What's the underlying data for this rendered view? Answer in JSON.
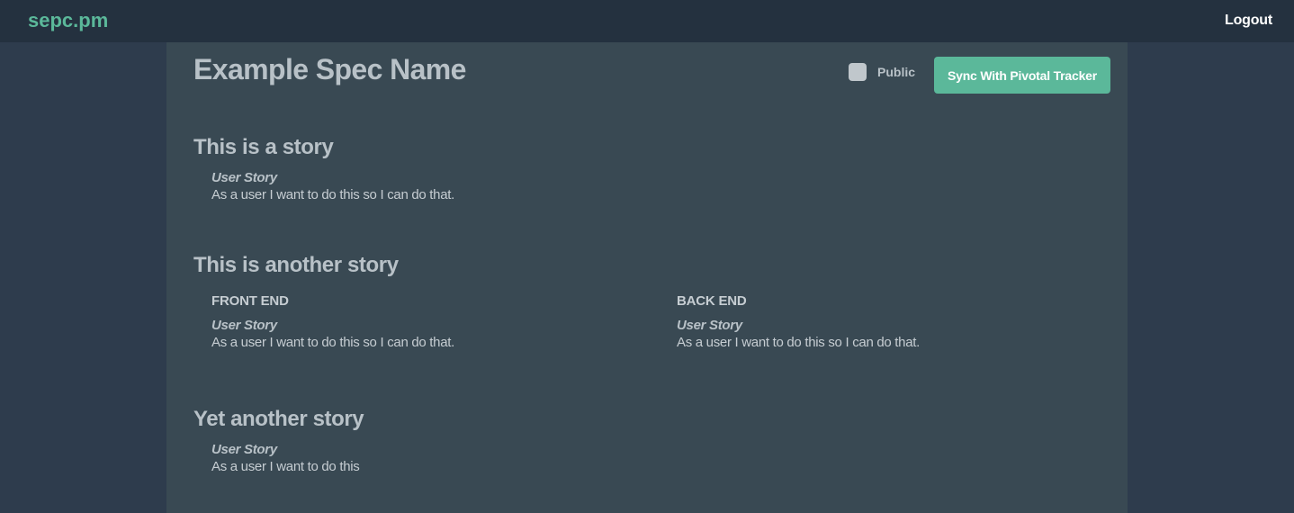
{
  "header": {
    "brand": "sepc.pm",
    "logout_label": "Logout"
  },
  "spec": {
    "title": "Example Spec Name",
    "public_label": "Public",
    "public_checked": false,
    "sync_button_label": "Sync With Pivotal Tracker"
  },
  "stories": [
    {
      "title": "This is a story",
      "label": "User Story",
      "text": "As a user I want to do this so I can do that."
    },
    {
      "title": "This is another story",
      "columns": [
        {
          "header": "FRONT END",
          "label": "User Story",
          "text": "As a user I want to do this so I can do that."
        },
        {
          "header": "BACK END",
          "label": "User Story",
          "text": "As a user I want to do this so I can do that."
        }
      ]
    },
    {
      "title": "Yet another story",
      "label": "User Story",
      "text": "As a user I want to do this"
    }
  ],
  "colors": {
    "accent": "#5bb89a",
    "topbar": "#24313f",
    "page_bg": "#2e3c4d",
    "content_bg": "#394953",
    "text": "#b8c1c7"
  }
}
